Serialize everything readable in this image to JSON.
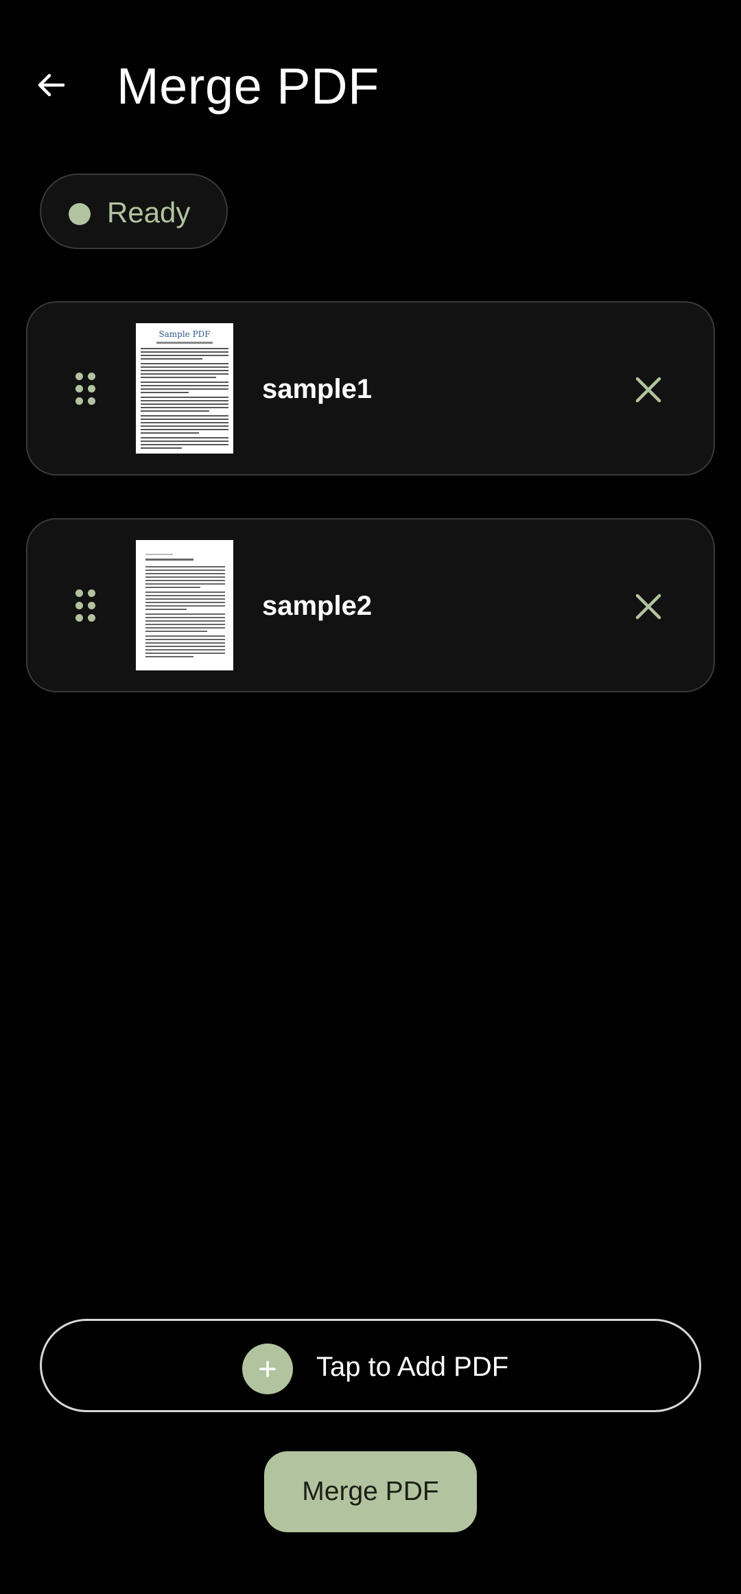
{
  "header": {
    "title": "Merge PDF",
    "back_icon": "arrow-left-icon"
  },
  "status": {
    "label": "Ready",
    "dot_color": "#b2c49f",
    "text_color": "#b2c49f"
  },
  "files": [
    {
      "name": "sample1",
      "thumbnail_title": "Sample PDF",
      "drag_icon": "drag-handle-icon",
      "remove_icon": "close-icon"
    },
    {
      "name": "sample2",
      "drag_icon": "drag-handle-icon",
      "remove_icon": "close-icon"
    }
  ],
  "add_pdf": {
    "label": "Tap to Add PDF",
    "icon": "plus-icon"
  },
  "merge_button": {
    "label": "Merge PDF"
  },
  "colors": {
    "background": "#000000",
    "card": "#121212",
    "card_border": "#3a3a3a",
    "accent": "#b2c49f",
    "text": "#ffffff"
  }
}
